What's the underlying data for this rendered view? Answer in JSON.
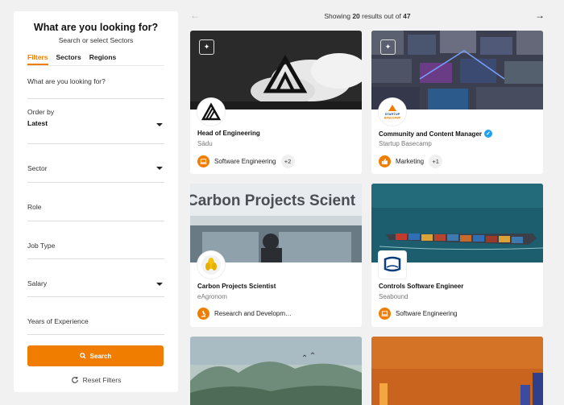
{
  "sidebar": {
    "title": "What are you looking for?",
    "subtitle": "Search or select Sectors",
    "tabs": [
      {
        "label": "Filters"
      },
      {
        "label": "Sectors"
      },
      {
        "label": "Regions"
      }
    ],
    "search_placeholder": "What are you looking for?",
    "order_by_label": "Order by",
    "order_by_value": "Latest",
    "sector_label": "Sector",
    "role_label": "Role",
    "job_type_label": "Job Type",
    "salary_label": "Salary",
    "experience_label": "Years of Experience",
    "search_button": "Search",
    "reset_label": "Reset Filters"
  },
  "results": {
    "prefix": "Showing ",
    "shown": "20",
    "middle": " results out of ",
    "total": "47"
  },
  "cards": [
    {
      "title": "Head of Engineering",
      "company": "Sādu",
      "category": "Software Engineering",
      "extra": "+2"
    },
    {
      "title": "Community and Content Manager",
      "company": "Startup Basecamp",
      "category": "Marketing",
      "extra": "+1",
      "logo_text_1": "STARTUP",
      "logo_text_2": "BASECAMP"
    },
    {
      "title": "Carbon Projects Scientist",
      "company": "eAgronom",
      "category": "Research and Developm…",
      "cover_text": "Carbon Projects Scient"
    },
    {
      "title": "Controls Software Engineer",
      "company": "Seabound",
      "category": "Software Engineering"
    }
  ],
  "colors": {
    "accent": "#f07d00",
    "verified": "#1da1f2"
  }
}
